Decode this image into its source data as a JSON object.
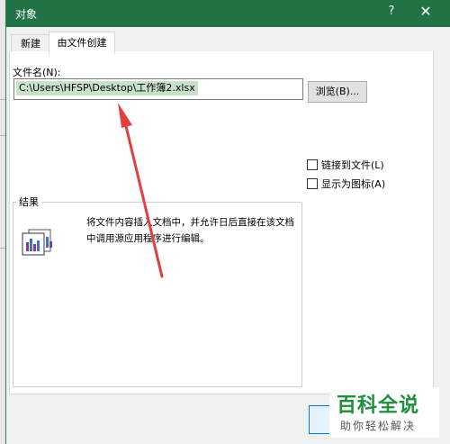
{
  "window": {
    "title": "对象",
    "help": "?",
    "close": "✕"
  },
  "tabs": [
    {
      "label": "新建",
      "active": false
    },
    {
      "label": "由文件创建",
      "active": true
    }
  ],
  "file": {
    "label": "文件名(N):",
    "value": "C:\\Users\\HFSP\\Desktop\\工作簿2.xlsx",
    "browse_label": "浏览(B)..."
  },
  "options": {
    "link_label": "链接到文件(L)",
    "icon_label": "显示为图标(A)"
  },
  "result": {
    "legend": "结果",
    "description": "将文件内容插入文档中，并允许日后直接在该文档中调用源应用程序进行编辑。",
    "icon": "embedded-object-icon"
  },
  "watermark": {
    "title": "百科全说",
    "subtitle": "助你轻松解决"
  },
  "colors": {
    "titlebar": "#217346",
    "selection": "#c7e2c8",
    "arrow": "#e0403e",
    "watermark": "#1f8e3d"
  }
}
